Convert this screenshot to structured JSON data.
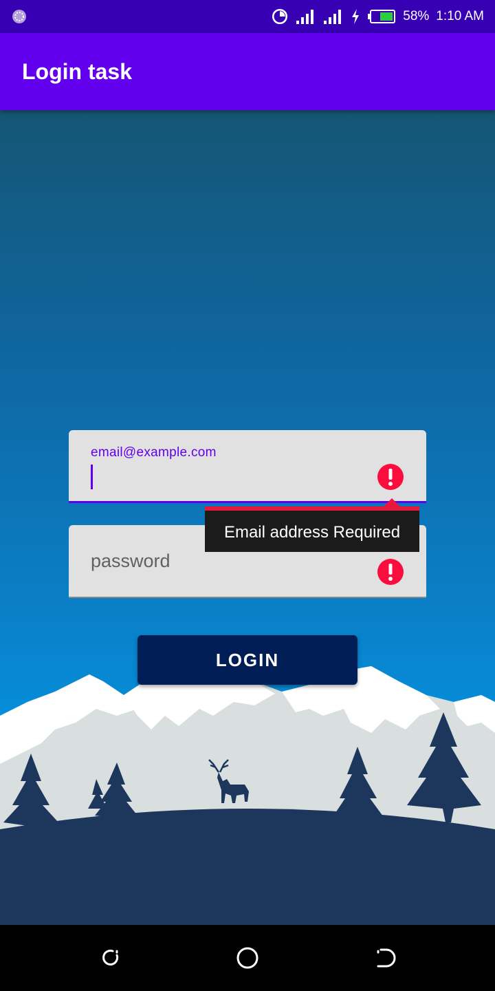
{
  "status_bar": {
    "battery": "58%",
    "time": "1:10 AM",
    "icons": [
      "app-notification-icon",
      "data-usage-icon",
      "signal-icon",
      "signal-icon",
      "charging-icon",
      "battery-icon"
    ]
  },
  "app_bar": {
    "title": "Login task"
  },
  "form": {
    "email": {
      "label": "email@example.com",
      "value": "",
      "error_icon": "error-icon"
    },
    "password": {
      "placeholder": "password",
      "error_icon": "error-icon"
    },
    "error_tooltip": "Email address Required",
    "login_label": "LOGIN"
  },
  "nav_bar": {
    "icons": [
      "recents-icon",
      "home-icon",
      "back-icon"
    ]
  },
  "colors": {
    "primary": "#6200ee",
    "primary_dark": "#3700b3",
    "error": "#e8173e",
    "button": "#001d56"
  }
}
